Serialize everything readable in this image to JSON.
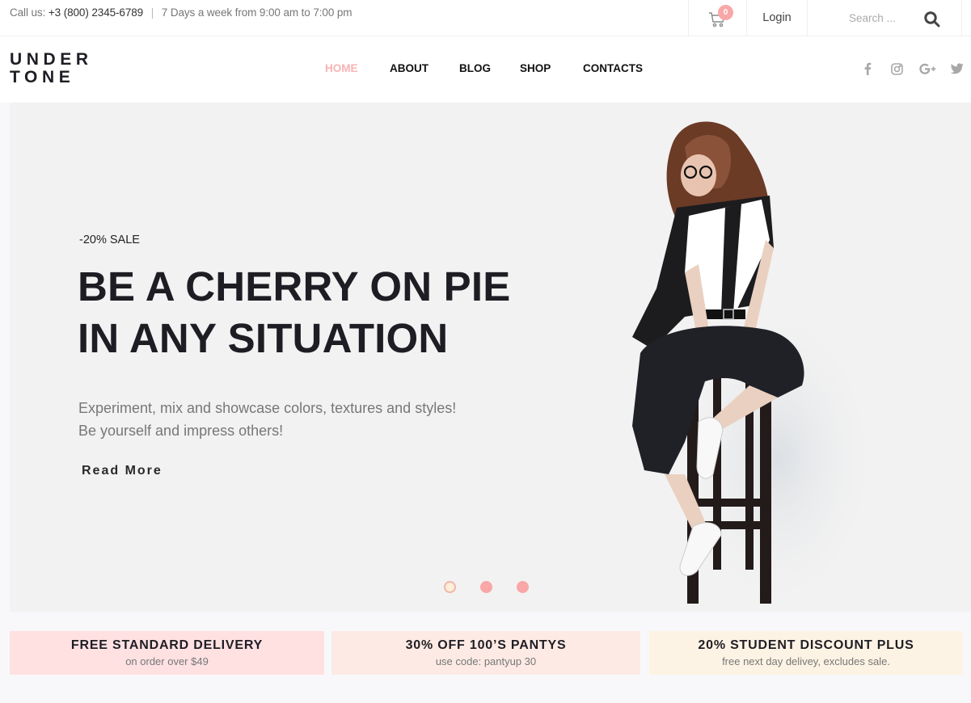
{
  "topbar": {
    "call_label": "Call us:",
    "phone": "+3 (800) 2345-6789",
    "separator": "|",
    "hours": "7 Days a week from 9:00 am to 7:00 pm",
    "cart_count": "0",
    "login_label": "Login",
    "search_placeholder": "Search ..."
  },
  "header": {
    "logo_line1": "UNDER",
    "logo_line2": "TONE",
    "nav": [
      {
        "label": "HOME",
        "active": true
      },
      {
        "label": "ABOUT",
        "active": false
      },
      {
        "label": "BLOG",
        "active": false
      },
      {
        "label": "SHOP",
        "active": false
      },
      {
        "label": "CONTACTS",
        "active": false
      }
    ],
    "social": [
      {
        "icon": "facebook-icon",
        "glyph": "f"
      },
      {
        "icon": "instagram-icon",
        "glyph": "◎"
      },
      {
        "icon": "google-plus-icon",
        "glyph": "G+"
      },
      {
        "icon": "twitter-icon",
        "glyph": "🐦"
      }
    ]
  },
  "hero": {
    "sale_tag": "-20% SALE",
    "headline_line1": "BE A CHERRY ON PIE",
    "headline_line2": "IN ANY SITUATION",
    "desc_line1": "Experiment, mix and showcase colors, textures and styles!",
    "desc_line2": "Be yourself and impress others!",
    "cta_label": "Read More",
    "slides_total": 3,
    "active_slide": 1
  },
  "promos": [
    {
      "title": "FREE STANDARD DELIVERY",
      "subtitle": "on order over $49",
      "bg": "#ffe1e2"
    },
    {
      "title": "30% OFF 100’S PANTYS",
      "subtitle": "use code: pantyup 30",
      "bg": "#fdeae4"
    },
    {
      "title": "20% STUDENT DISCOUNT PLUS",
      "subtitle": "free next day delivey, excludes sale.",
      "bg": "#fdf3e4"
    }
  ],
  "colors": {
    "accent": "#f7b3b5",
    "dot": "#f9a7a7",
    "text_dark": "#1f1d24",
    "hero_bg": "#f2f2f2"
  }
}
